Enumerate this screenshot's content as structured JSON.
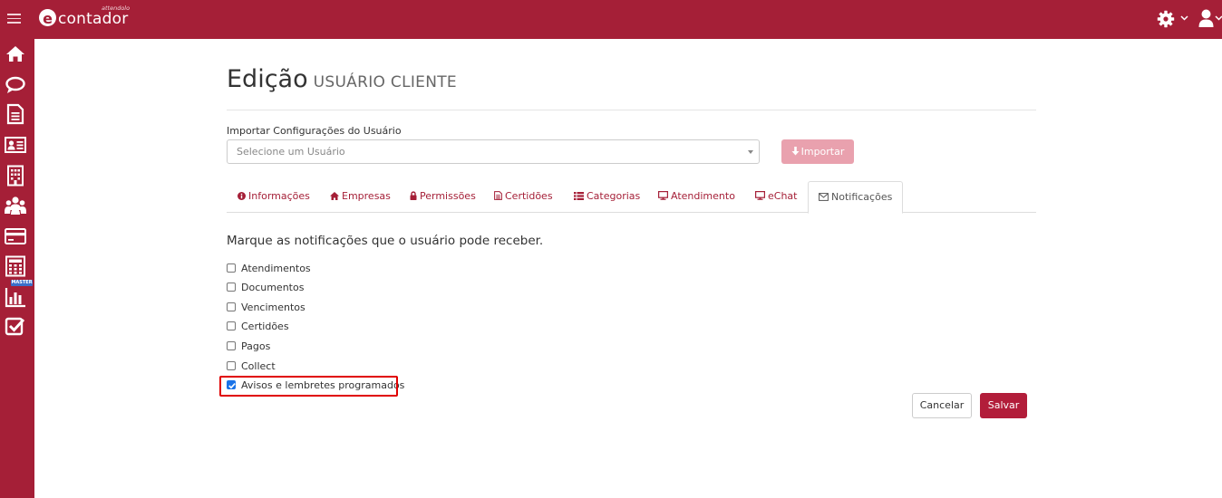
{
  "app": {
    "logo_text": "contador",
    "logo_sub": "attendolo"
  },
  "colors": {
    "brand": "#a51f37",
    "tab_text": "#a51f37",
    "save_button": "#b21d3a",
    "import_button_disabled": "#e9a1ae",
    "highlight": "#e00000",
    "checkbox_checked": "#1a73e8"
  },
  "topbar": {
    "menu_icon": "hamburger-icon",
    "settings_icon": "gear-icon",
    "user_icon": "user-icon"
  },
  "sidebar": {
    "items": [
      {
        "icon": "home-icon"
      },
      {
        "icon": "chat-icon"
      },
      {
        "icon": "document-icon"
      },
      {
        "icon": "id-card-icon"
      },
      {
        "icon": "building-icon"
      },
      {
        "icon": "users-icon"
      },
      {
        "icon": "credit-card-icon"
      },
      {
        "icon": "calculator-icon"
      },
      {
        "icon": "bar-chart-icon",
        "badge": "MASTER"
      },
      {
        "icon": "checkbox-icon"
      }
    ]
  },
  "page": {
    "title": "Edição",
    "subtitle": "USUÁRIO CLIENTE"
  },
  "import": {
    "label": "Importar Configurações do Usuário",
    "placeholder": "Selecione um Usuário",
    "button_label": "Importar"
  },
  "tabs": [
    {
      "label": "Informações",
      "icon": "info-icon"
    },
    {
      "label": "Empresas",
      "icon": "home-icon"
    },
    {
      "label": "Permissões",
      "icon": "lock-icon"
    },
    {
      "label": "Certidões",
      "icon": "document-icon"
    },
    {
      "label": "Categorias",
      "icon": "list-icon"
    },
    {
      "label": "Atendimento",
      "icon": "monitor-icon"
    },
    {
      "label": "eChat",
      "icon": "monitor-icon"
    },
    {
      "label": "Notificações",
      "icon": "envelope-icon",
      "active": true
    }
  ],
  "notifications": {
    "heading": "Marque as notificações que o usuário pode receber.",
    "options": [
      {
        "label": "Atendimentos",
        "checked": false
      },
      {
        "label": "Documentos",
        "checked": false
      },
      {
        "label": "Vencimentos",
        "checked": false
      },
      {
        "label": "Certidões",
        "checked": false
      },
      {
        "label": "Pagos",
        "checked": false
      },
      {
        "label": "Collect",
        "checked": false
      },
      {
        "label": "Avisos e lembretes programados",
        "checked": true
      }
    ]
  },
  "actions": {
    "cancel_label": "Cancelar",
    "save_label": "Salvar"
  }
}
